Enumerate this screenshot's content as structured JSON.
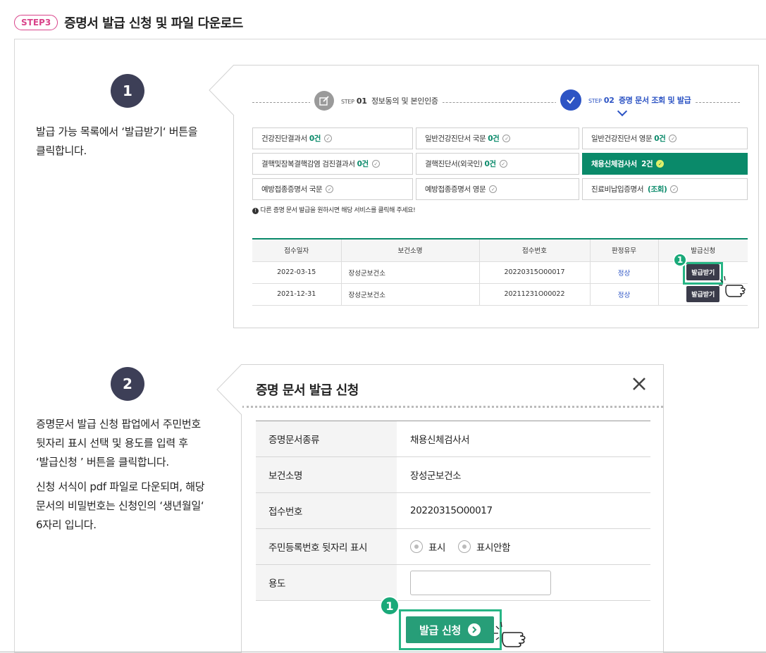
{
  "header": {
    "step_badge": "STEP3",
    "title": "증명서 발급 신청 및 파일 다운로드"
  },
  "steps": [
    {
      "number": "1",
      "desc_lines": [
        "발급 가능 목록에서 ‘발급받기‘ 버튼을",
        "클릭합니다."
      ]
    },
    {
      "number": "2",
      "desc_lines": [
        "증명문서 발급 신청 팝업에서 주민번호",
        "뒷자리 표시 선택 및 용도를 입력 후",
        "‘발급신청 ’ 버튼을 클릭합니다."
      ],
      "desc2_lines": [
        "신청 서식이 pdf 파일로 다운되며, 해당",
        "문서의 비밀번호는 신청인의 ‘생년월일‘",
        "6자리 입니다."
      ]
    }
  ],
  "screen1": {
    "progress": {
      "step1_prefix": "STEP",
      "step1_num": "01",
      "step1_label": "정보동의 및 본인인증",
      "step2_prefix": "STEP",
      "step2_num": "02",
      "step2_label": "증명 문서 조회 및 발급",
      "step1_icon": "edit-icon",
      "step2_icon": "check-icon"
    },
    "doc_types": [
      {
        "label": "건강진단결과서",
        "count": "0건"
      },
      {
        "label": "일반건강진단서 국문",
        "count": "0건"
      },
      {
        "label": "일반건강진단서 영문",
        "count": "0건"
      },
      {
        "label": "결핵및잠복결핵감염 검진결과서",
        "count": "0건"
      },
      {
        "label": "결핵진단서(외국인)",
        "count": "0건"
      },
      {
        "label": "채용신체검사서",
        "count": "2건",
        "active": true
      },
      {
        "label": "예방접종증명서 국문",
        "count": ""
      },
      {
        "label": "예방접종증명서 영문",
        "count": ""
      },
      {
        "label": "진료비납입증명서",
        "count": "(조회)"
      }
    ],
    "notice": "다른 증명 문서 발급을 원하시면 해당 서비스를 클릭해 주세요!",
    "table": {
      "headers": [
        "접수일자",
        "보건소명",
        "접수번호",
        "판정유무",
        "발급신청"
      ],
      "rows": [
        {
          "date": "2022-03-15",
          "center": "장성군보건소",
          "receipt": "20220315O00017",
          "result": "정상",
          "action": "발급받기"
        },
        {
          "date": "2021-12-31",
          "center": "장성군보건소",
          "receipt": "20211231O00022",
          "result": "정상",
          "action": "발급받기"
        }
      ]
    },
    "callout_number": "1"
  },
  "screen2": {
    "title": "증명 문서 발급 신청",
    "close_icon": "close-icon",
    "fields": [
      {
        "label": "증명문서종류",
        "value": "채용신체검사서"
      },
      {
        "label": "보건소명",
        "value": "장성군보건소"
      },
      {
        "label": "접수번호",
        "value": "20220315O00017"
      }
    ],
    "ssn_label": "주민등록번호 뒷자리 표시",
    "ssn_options": [
      "표시",
      "표시안함"
    ],
    "usage_label": "용도",
    "usage_value": "",
    "submit_label": "발급 신청",
    "callout_number": "1"
  },
  "colors": {
    "accent_green": "#0a8a6a",
    "step_pink": "#d9438a",
    "step_blue": "#2d54c4",
    "dark_button": "#3a3b4a"
  }
}
